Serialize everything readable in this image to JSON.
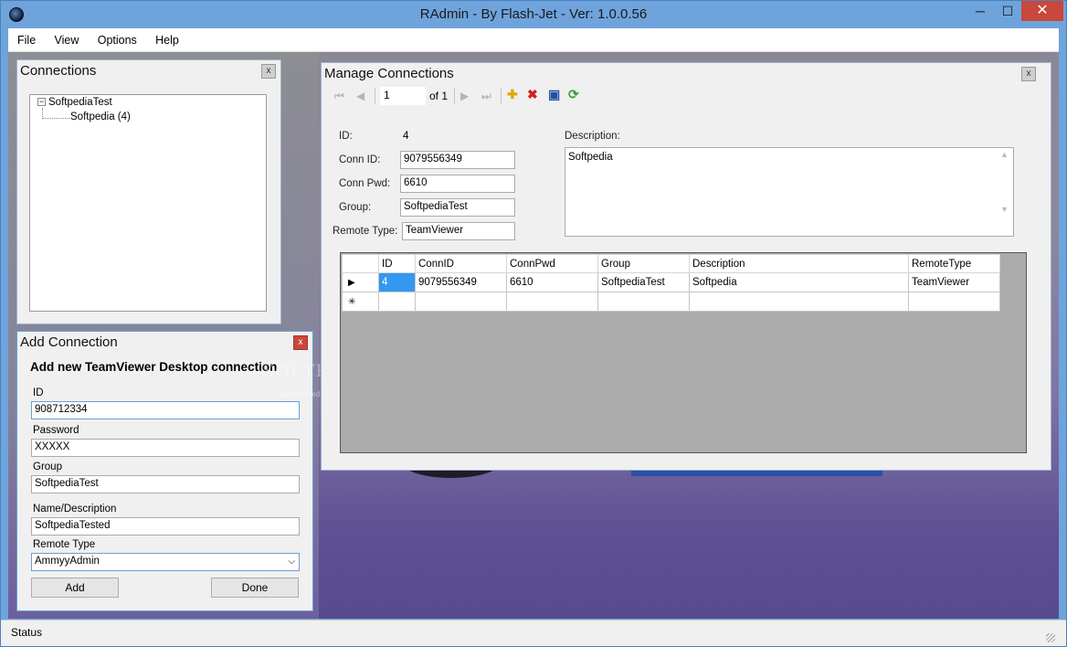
{
  "window": {
    "title": "RAdmin - By Flash-Jet - Ver: 1.0.0.56",
    "minimize": "─",
    "maximize": "☐",
    "close": "✕"
  },
  "menu": [
    "File",
    "View",
    "Options",
    "Help"
  ],
  "status": "Status",
  "watermark": {
    "line1": "SOFTPEDIA",
    "line2": "www.softpedia.com"
  },
  "connections": {
    "title": "Connections",
    "close": "x",
    "tree": {
      "group": "SoftpediaTest",
      "child": "Softpedia (4)",
      "expander": "−"
    }
  },
  "add_connection": {
    "title": "Add Connection",
    "close": "x",
    "heading": "Add new TeamViewer Desktop  connection",
    "fields": {
      "id_label": "ID",
      "id_value": "908712334",
      "password_label": "Password",
      "password_value": "XXXXX",
      "group_label": "Group",
      "group_value": "SoftpediaTest",
      "name_label": "Name/Description",
      "name_value": "SoftpediaTested",
      "type_label": "Remote Type",
      "type_value": "AmmyyAdmin"
    },
    "add_button": "Add",
    "done_button": "Done"
  },
  "manage": {
    "title": "Manage Connections",
    "close": "x",
    "navigator": {
      "page": "1",
      "of": "of 1"
    },
    "form": {
      "id_label": "ID:",
      "id_value": "4",
      "connid_label": "Conn ID:",
      "connid_value": "9079556349",
      "pwd_label": "Conn Pwd:",
      "pwd_value": "6610",
      "group_label": "Group:",
      "group_value": "SoftpediaTest",
      "type_label": "Remote Type:",
      "type_value": "TeamViewer",
      "desc_label": "Description:",
      "desc_value": "Softpedia"
    },
    "grid": {
      "columns": [
        "ID",
        "ConnID",
        "ConnPwd",
        "Group",
        "Description",
        "RemoteType"
      ],
      "rows": [
        [
          "4",
          "9079556349",
          "6610",
          "SoftpediaTest",
          "Softpedia",
          "TeamViewer"
        ]
      ],
      "current_marker": "▶",
      "new_marker": "✳"
    }
  }
}
